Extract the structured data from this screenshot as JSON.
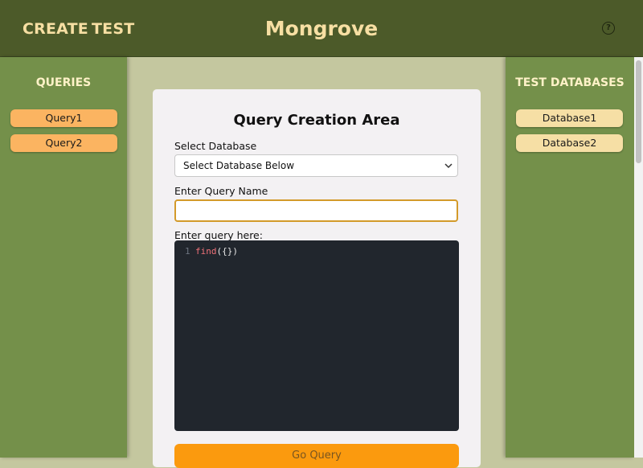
{
  "header": {
    "nav": [
      "CREATE",
      "TEST"
    ],
    "title": "Mongrove",
    "help_icon": "question-circle-icon",
    "help_glyph": "?"
  },
  "queries_panel": {
    "heading": "QUERIES",
    "items": [
      "Query1",
      "Query2"
    ]
  },
  "databases_panel": {
    "heading": "TEST DATABASES",
    "items": [
      "Database1",
      "Database2"
    ]
  },
  "form": {
    "title": "Query Creation Area",
    "select_label": "Select Database",
    "select_value": "Select Database Below",
    "name_label": "Enter Query Name",
    "name_value": "",
    "query_label": "Enter query here:",
    "editor": {
      "line_number": "1",
      "code_fn": "find",
      "code_rest": "({})"
    },
    "submit_label": "Go Query"
  },
  "colors": {
    "header_bg": "#4c5a29",
    "sidebar_bg": "#74904a",
    "accent_orange": "#fb9a0e",
    "query_btn": "#fbb461",
    "db_btn": "#f6dfa5",
    "editor_bg": "#21262d"
  }
}
